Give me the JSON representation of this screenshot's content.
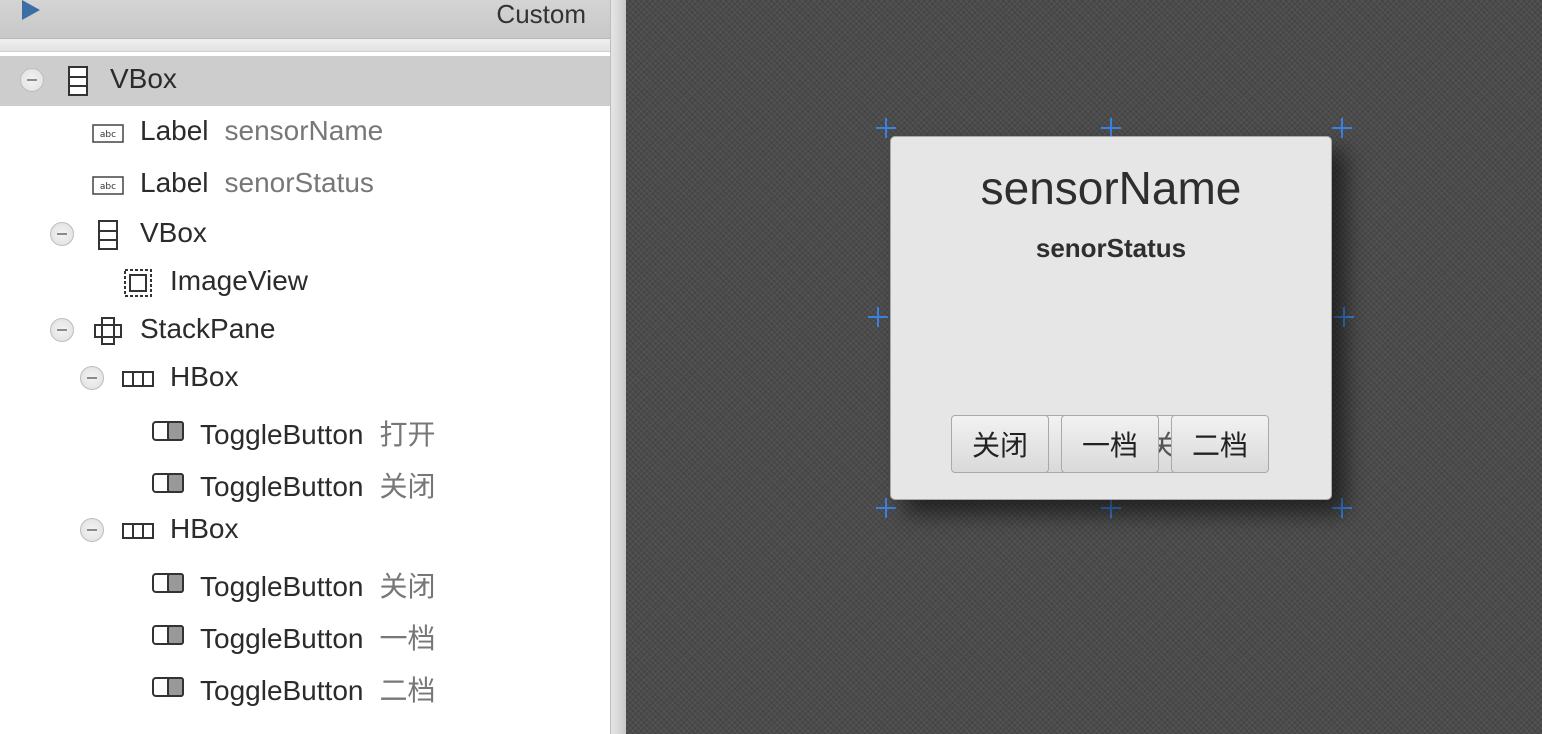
{
  "header": {
    "title": "Custom"
  },
  "tree": [
    {
      "type": "VBox",
      "id": "",
      "expandable": true,
      "selected": true,
      "icon": "vbox-icon"
    },
    {
      "type": "Label",
      "id": "sensorName",
      "expandable": false,
      "icon": "label-icon"
    },
    {
      "type": "Label",
      "id": "senorStatus",
      "expandable": false,
      "icon": "label-icon"
    },
    {
      "type": "VBox",
      "id": "",
      "expandable": true,
      "icon": "vbox-icon"
    },
    {
      "type": "ImageView",
      "id": "",
      "expandable": false,
      "icon": "imageview-icon"
    },
    {
      "type": "StackPane",
      "id": "",
      "expandable": true,
      "icon": "stackpane-icon"
    },
    {
      "type": "HBox",
      "id": "",
      "expandable": true,
      "icon": "hbox-icon"
    },
    {
      "type": "ToggleButton",
      "id": "打开",
      "expandable": false,
      "icon": "togglebutton-icon"
    },
    {
      "type": "ToggleButton",
      "id": "关闭",
      "expandable": false,
      "icon": "togglebutton-icon"
    },
    {
      "type": "HBox",
      "id": "",
      "expandable": true,
      "icon": "hbox-icon"
    },
    {
      "type": "ToggleButton",
      "id": "关闭",
      "expandable": false,
      "icon": "togglebutton-icon"
    },
    {
      "type": "ToggleButton",
      "id": "一档",
      "expandable": false,
      "icon": "togglebutton-icon"
    },
    {
      "type": "ToggleButton",
      "id": "二档",
      "expandable": false,
      "icon": "togglebutton-icon"
    }
  ],
  "preview": {
    "title": "sensorName",
    "status": "senorStatus",
    "back_buttons": [
      "打开",
      "关闭"
    ],
    "front_buttons": [
      "关闭",
      "一档",
      "二档"
    ]
  },
  "colors": {
    "selection_accent": "#3b82e0",
    "selected_row": "#cdcdcd"
  }
}
